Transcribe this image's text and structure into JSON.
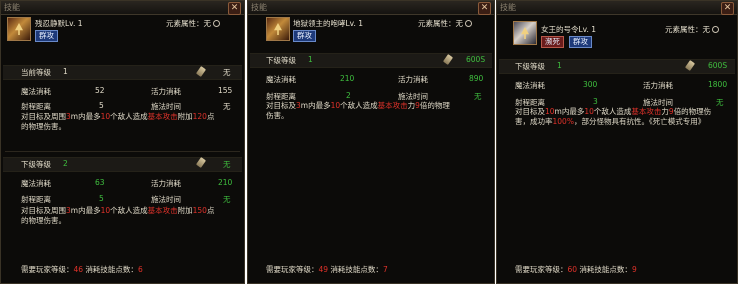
{
  "panel1": {
    "title": "技能",
    "skill_name": "残忍静默Lv. 1",
    "element": "元素属性：无",
    "tags": [
      "群攻"
    ],
    "current": {
      "label": "当前等级",
      "level": "1",
      "cost": "无",
      "mana_label": "魔法消耗",
      "mana": "52",
      "vitality_label": "活力消耗",
      "vitality": "155",
      "range_label": "射程距离",
      "range": "5",
      "cast_label": "施法时间",
      "cast": "无",
      "desc_a": "对目标及周围",
      "desc_b": "3",
      "desc_c": "m内最多",
      "desc_d": "10",
      "desc_e": "个敌人造成",
      "desc_f": "基本攻击",
      "desc_g": "附加",
      "desc_h": "120",
      "desc_i": "点",
      "desc_j": "的物理伤害。"
    },
    "next": {
      "label": "下级等级",
      "level": "2",
      "cost": "无",
      "mana_label": "魔法消耗",
      "mana": "63",
      "vitality_label": "活力消耗",
      "vitality": "210",
      "range_label": "射程距离",
      "range": "5",
      "cast_label": "施法时间",
      "cast": "无",
      "desc_a": "对目标及周围",
      "desc_b": "3",
      "desc_c": "m内最多",
      "desc_d": "10",
      "desc_e": "个敌人造成",
      "desc_f": "基本攻击",
      "desc_g": "附加",
      "desc_h": "150",
      "desc_i": "点",
      "desc_j": "的物理伤害。"
    },
    "footer": {
      "a": "需要玩家等级：",
      "level": "46",
      "b": "消耗技能点数：",
      "points": "6"
    }
  },
  "panel2": {
    "title": "技能",
    "skill_name": "地狱领主的咆哮Lv. 1",
    "element": "元素属性：无",
    "tags": [
      "群攻"
    ],
    "next": {
      "label": "下级等级",
      "level": "1",
      "cost": "600S",
      "mana_label": "魔法消耗",
      "mana": "210",
      "vitality_label": "活力消耗",
      "vitality": "890",
      "range_label": "射程距离",
      "range": "2",
      "cast_label": "施法时间",
      "cast": "无",
      "desc_a": "对目标及",
      "desc_b": "3",
      "desc_c": "m内最多",
      "desc_d": "10",
      "desc_e": "个敌人造成",
      "desc_f": "基本攻击",
      "desc_g": "力",
      "desc_h": "9",
      "desc_i": "倍的物理",
      "desc_j": "伤害。"
    },
    "footer": {
      "a": "需要玩家等级：",
      "level": "49",
      "b": "消耗技能点数：",
      "points": "7"
    }
  },
  "panel3": {
    "title": "技能",
    "skill_name": "女王的号令Lv. 1",
    "element": "元素属性：无",
    "tags": [
      "濒死",
      "群攻"
    ],
    "next": {
      "label": "下级等级",
      "level": "1",
      "cost": "600S",
      "mana_label": "魔法消耗",
      "mana": "300",
      "vitality_label": "活力消耗",
      "vitality": "1800",
      "range_label": "射程距离",
      "range": "3",
      "cast_label": "施法时间",
      "cast": "无",
      "desc_a": "对目标及",
      "desc_b": "10",
      "desc_c": "m内最多",
      "desc_d": "10",
      "desc_e": "个敌人造成",
      "desc_f": "基本攻击",
      "desc_g": "力",
      "desc_h": "9",
      "desc_i": "倍的物理伤",
      "desc_j": "害，成功率",
      "desc_k": "100%",
      "desc_l": "，部分怪物具有抗性。《死亡模式专用》"
    },
    "footer": {
      "a": "需要玩家等级：",
      "level": "60",
      "b": "消耗技能点数：",
      "points": "9"
    }
  },
  "icons": {
    "close": "close-icon",
    "skill": "skill-icon",
    "scroll": "scroll-icon",
    "element": "circle-icon"
  }
}
